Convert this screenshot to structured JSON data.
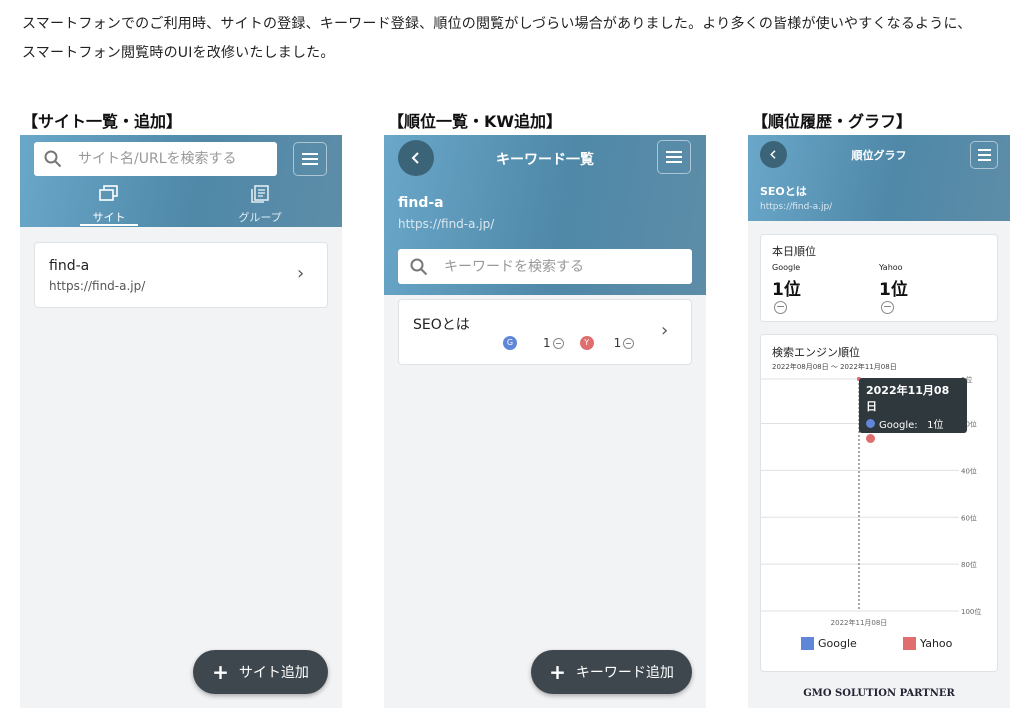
{
  "intro": {
    "line1": "スマートフォンでのご利用時、サイトの登録、キーワード登録、順位の閲覧がしづらい場合がありました。より多くの皆様が使いやすくなるように、",
    "line2": "スマートフォン閲覧時のUIを改修いたしました。"
  },
  "panel1": {
    "caption": "【サイト一覧・追加】",
    "search_placeholder": "サイト名/URLを検索する",
    "tabs": [
      {
        "label": "サイト",
        "active": true
      },
      {
        "label": "グループ",
        "active": false
      }
    ],
    "site": {
      "name": "find-a",
      "url": "https://find-a.jp/"
    },
    "fab_label": "サイト追加"
  },
  "panel2": {
    "caption": "【順位一覧・KW追加】",
    "title": "キーワード一覧",
    "site_name": "find-a",
    "site_url": "https://find-a.jp/",
    "search_placeholder": "キーワードを検索する",
    "keyword": {
      "name": "SEOとは",
      "google_badge": "G",
      "google_rank": "1",
      "yahoo_badge": "Y",
      "yahoo_rank": "1"
    },
    "fab_label": "キーワード追加"
  },
  "panel3": {
    "caption": "【順位履歴・グラフ】",
    "title": "順位グラフ",
    "keyword": "SEOとは",
    "url": "https://find-a.jp/",
    "today": {
      "title": "本日順位",
      "google_label": "Google",
      "google_rank": "1位",
      "yahoo_label": "Yahoo",
      "yahoo_rank": "1位"
    },
    "graph": {
      "title": "検索エンジン順位",
      "range": "2022年08月08日 ～ 2022年11月08日",
      "x_label": "2022年11月08日",
      "tooltip": {
        "date": "2022年11月08日",
        "google": "Google:   1位",
        "yahoo": "Yahoo:    1位"
      },
      "legend": [
        "Google",
        "Yahoo"
      ]
    },
    "footer_logo": "GMO SOLUTION PARTNER"
  },
  "colors": {
    "header_blue": "#4f88a8",
    "google": "#5f86d8",
    "yahoo": "#e06e6e",
    "fab": "#3e474d"
  },
  "chart_data": {
    "type": "line",
    "ylabel": "",
    "y_ticks": [
      "1位",
      "20位",
      "40位",
      "60位",
      "80位",
      "100位"
    ],
    "ylim": [
      1,
      100
    ],
    "y_inverted": true,
    "x": [
      "2022年11月08日"
    ],
    "series": [
      {
        "name": "Google",
        "values": [
          1
        ]
      },
      {
        "name": "Yahoo",
        "values": [
          1
        ]
      }
    ],
    "grid": true,
    "legend": "bottom"
  }
}
